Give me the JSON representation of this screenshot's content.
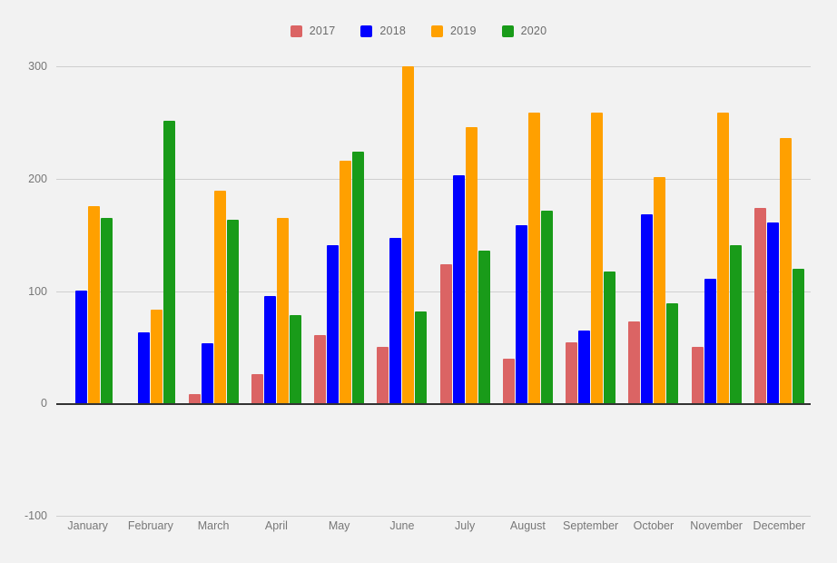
{
  "chart_data": {
    "type": "bar",
    "title": "",
    "subtitle": "",
    "xlabel": "",
    "ylabel": "",
    "ylim": [
      -100,
      300
    ],
    "yticks": [
      300,
      200,
      100,
      0,
      -100
    ],
    "ytick_labels": [
      "300",
      "200",
      "100",
      "0",
      "-100"
    ],
    "grid": true,
    "legend_position": "top-center",
    "categories": [
      "January",
      "February",
      "March",
      "April",
      "May",
      "June",
      "July",
      "August",
      "September",
      "October",
      "November",
      "December"
    ],
    "series": [
      {
        "name": "2017",
        "color": "#db6464",
        "values": [
          0,
          0,
          8,
          26,
          61,
          50,
          124,
          40,
          54,
          73,
          50,
          174
        ]
      },
      {
        "name": "2018",
        "color": "#0000ff",
        "values": [
          100,
          63,
          53,
          95,
          141,
          147,
          203,
          158,
          65,
          168,
          111,
          161
        ]
      },
      {
        "name": "2019",
        "color": "#ffa000",
        "values": [
          175,
          83,
          189,
          165,
          216,
          300,
          246,
          259,
          259,
          201,
          259,
          236
        ]
      },
      {
        "name": "2020",
        "color": "#199b19",
        "values": [
          165,
          251,
          163,
          78,
          224,
          82,
          136,
          171,
          117,
          89,
          141,
          120
        ]
      }
    ]
  },
  "colors": {
    "background": "#f2f2f2",
    "gridline": "#cfcfcf",
    "zero_axis": "#333333",
    "tick_text": "#777777",
    "legend_text": "#6b6b6b"
  }
}
